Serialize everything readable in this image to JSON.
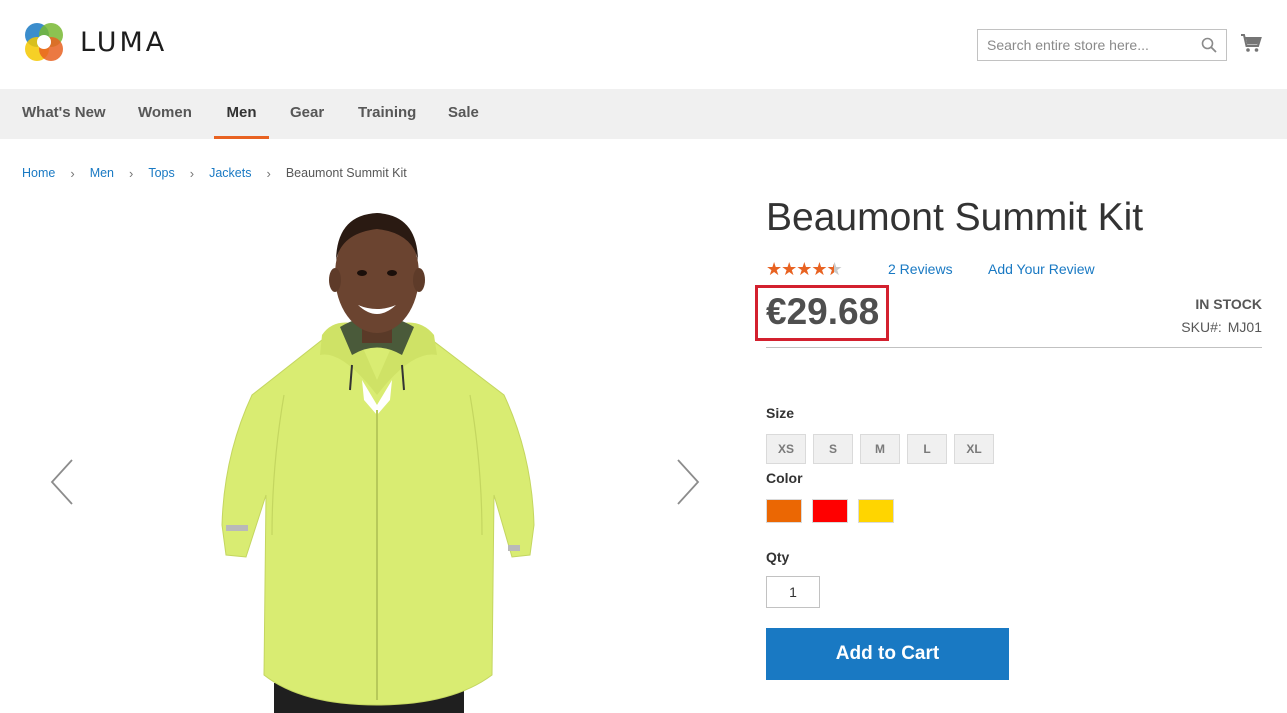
{
  "header": {
    "logo_text": "LUMA",
    "search_placeholder": "Search entire store here...",
    "icons": {
      "search": "search-icon",
      "cart": "cart-icon",
      "logo": "luma-logo-icon"
    }
  },
  "nav": {
    "items": [
      {
        "label": "What's New"
      },
      {
        "label": "Women"
      },
      {
        "label": "Men",
        "active": true
      },
      {
        "label": "Gear"
      },
      {
        "label": "Training"
      },
      {
        "label": "Sale"
      }
    ]
  },
  "breadcrumb": {
    "items": [
      "Home",
      "Men",
      "Tops",
      "Jackets"
    ],
    "current": "Beaumont Summit Kit"
  },
  "gallery": {
    "prev_icon": "chevron-left-icon",
    "next_icon": "chevron-right-icon"
  },
  "product": {
    "title": "Beaumont Summit Kit",
    "rating": {
      "stars": 4.5,
      "max": 5
    },
    "reviews_link": "2  Reviews",
    "add_review_link": "Add Your Review",
    "price": "€29.68",
    "stock": "IN STOCK",
    "sku_label": "SKU#:",
    "sku_value": "MJ01",
    "size_label": "Size",
    "sizes": [
      "XS",
      "S",
      "M",
      "L",
      "XL"
    ],
    "color_label": "Color",
    "colors": [
      "#eb6703",
      "#ff0000",
      "#ffd500"
    ],
    "qty_label": "Qty",
    "qty_value": "1",
    "add_to_cart_label": "Add to Cart"
  },
  "colors": {
    "accent": "#1979c3",
    "nav_active_underline": "#e86221",
    "highlight_box": "#d3202e",
    "jacket": "#d9ec72"
  }
}
